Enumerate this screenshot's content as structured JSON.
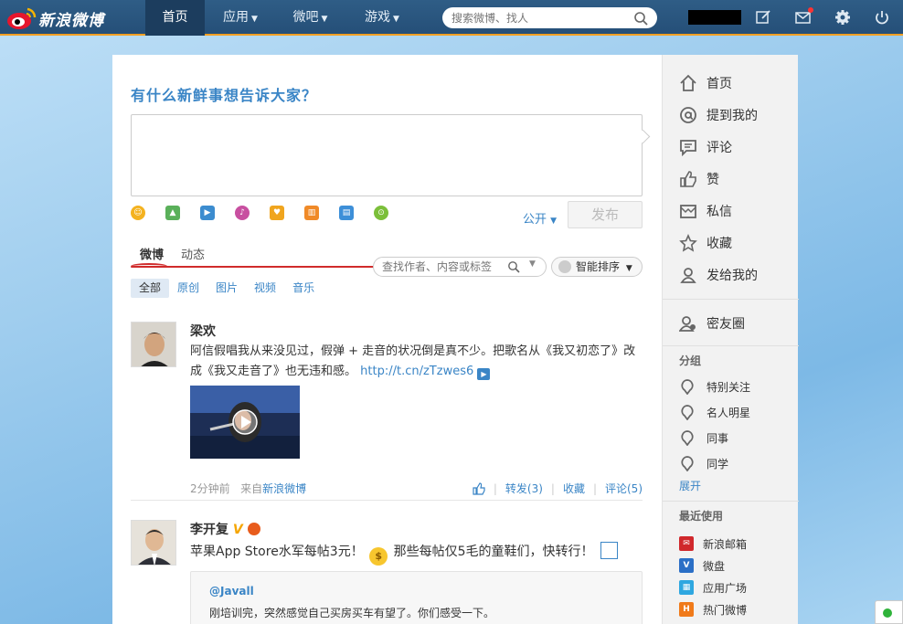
{
  "header": {
    "logo_text": "新浪微博",
    "nav": [
      {
        "label": "首页",
        "dropdown": false,
        "active": true
      },
      {
        "label": "应用",
        "dropdown": true
      },
      {
        "label": "微吧",
        "dropdown": true
      },
      {
        "label": "游戏",
        "dropdown": true
      }
    ],
    "search_placeholder": "搜索微博、找人"
  },
  "composer": {
    "prompt": "有什么新鲜事想告诉大家？",
    "visibility": "公开",
    "publish_label": "发布",
    "tools": [
      "emoji-icon",
      "image-icon",
      "video-icon",
      "music-icon",
      "topic-icon",
      "vote-icon",
      "long-text-icon",
      "more-icon"
    ]
  },
  "feed": {
    "tabs": [
      "微博",
      "动态"
    ],
    "search_placeholder": "查找作者、内容或标签",
    "sort_label": "智能排序",
    "filters": [
      "全部",
      "原创",
      "图片",
      "视频",
      "音乐"
    ],
    "posts": [
      {
        "author": "梁欢",
        "text": "阿信假唱我从来没见过，假弹 + 走音的状况倒是真不少。把歌名从《我又初恋了》改成《我又走音了》也无违和感。",
        "link": "http://t.cn/zTzwes6",
        "time": "2分钟前",
        "source_prefix": "来自",
        "source": "新浪微博",
        "repost": "转发(3)",
        "favorite": "收藏",
        "comment": "评论(5)"
      },
      {
        "author": "李开复",
        "text": "苹果App Store水军每帖3元！",
        "text2": "那些每帖仅5毛的童鞋们，快转行！",
        "quote_author": "@Javall",
        "quote_text": "刚培训完，突然感觉自己买房买车有望了。你们感受一下。"
      }
    ]
  },
  "sidebar": {
    "nav": [
      {
        "label": "首页",
        "icon": "home-icon"
      },
      {
        "label": "提到我的",
        "icon": "at-icon"
      },
      {
        "label": "评论",
        "icon": "comment-icon"
      },
      {
        "label": "赞",
        "icon": "like-icon"
      },
      {
        "label": "私信",
        "icon": "message-icon"
      },
      {
        "label": "收藏",
        "icon": "star-icon"
      },
      {
        "label": "发给我的",
        "icon": "person-icon"
      }
    ],
    "close_friends": "密友圈",
    "group_title": "分组",
    "groups": [
      "特别关注",
      "名人明星",
      "同事",
      "同学"
    ],
    "expand": "展开",
    "recent_title": "最近使用",
    "recent": [
      {
        "label": "新浪邮箱",
        "icon": "mail-app-icon",
        "color": "#d0282c"
      },
      {
        "label": "微盘",
        "icon": "vdisk-app-icon",
        "color": "#2b6fc6"
      },
      {
        "label": "应用广场",
        "icon": "app-square-icon",
        "color": "#2fa7e0"
      },
      {
        "label": "热门微博",
        "icon": "hot-weibo-icon",
        "color": "#f07a1a"
      }
    ]
  },
  "colors": {
    "accent": "#3a85c6",
    "topbar": "#2a5680",
    "tab_underline": "#d02b2b"
  }
}
